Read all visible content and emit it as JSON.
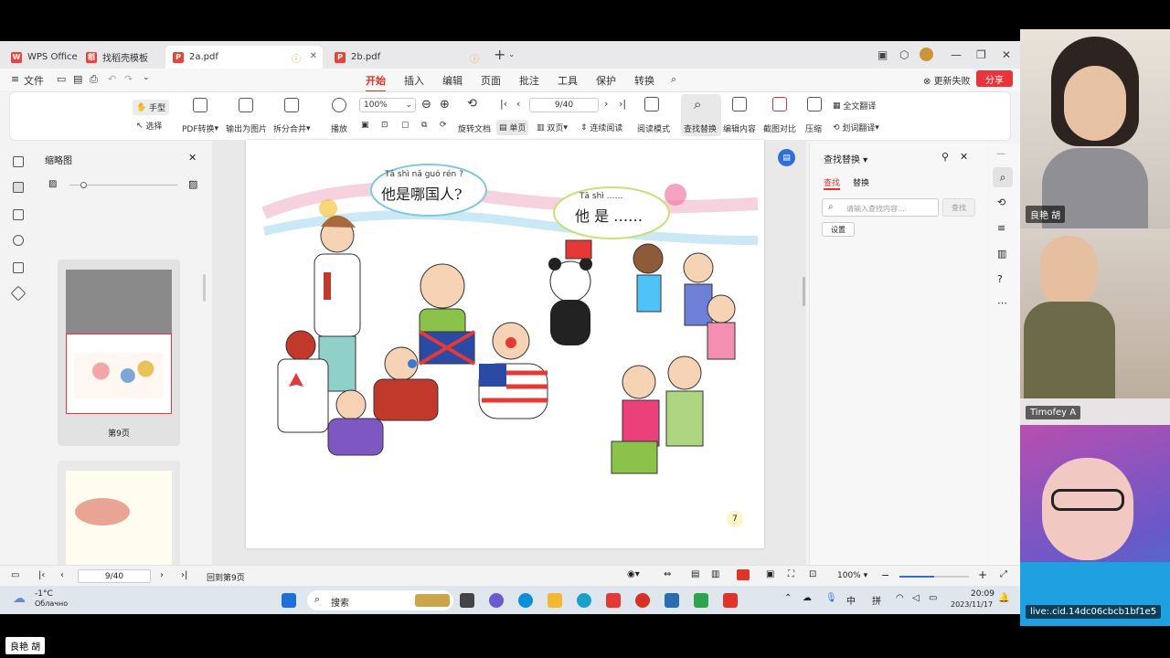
{
  "tabs": [
    {
      "label": "WPS Office"
    },
    {
      "label": "找稻壳模板"
    },
    {
      "label": "2a.pdf"
    },
    {
      "label": "2b.pdf"
    }
  ],
  "menu": {
    "file": "文件",
    "items": [
      "开始",
      "插入",
      "编辑",
      "页面",
      "批注",
      "工具",
      "保护",
      "转换"
    ],
    "update_fail": "更新失败",
    "share": "分享"
  },
  "toolbar": {
    "hand": "手型",
    "select": "选择",
    "pdf_convert": "PDF转换",
    "export_image": "输出为图片",
    "split_merge": "拆分合并",
    "play": "播放",
    "zoom": "100%",
    "rotate_doc": "旋转文档",
    "single_page": "单页",
    "double_page": "双页",
    "continuous": "连续阅读",
    "read_mode": "阅读模式",
    "find_replace": "查找替换",
    "edit_content": "编辑内容",
    "screenshot_compare": "截图对比",
    "compress": "压缩",
    "full_translate": "全文翻译",
    "word_translate": "划词翻译",
    "page_input": "9/40"
  },
  "thumbnails": {
    "title": "缩略图",
    "page_label": "第9页"
  },
  "page_content": {
    "bubble1_pinyin": "Tā shì nǎ guó rén ?",
    "bubble1_text": "他是哪国人?",
    "bubble2_pinyin": "Tā shì ……",
    "bubble2_text": "他 是 ……",
    "page_number": "7"
  },
  "find_panel": {
    "title": "查找替换",
    "tab_find": "查找",
    "tab_replace": "替换",
    "placeholder": "请输入查找内容...",
    "find_button": "查找",
    "settings_button": "设置"
  },
  "statusbar": {
    "page_input": "9/40",
    "back_label": "回到第9页",
    "zoom": "100%"
  },
  "taskbar": {
    "temp": "-1°C",
    "weather": "Облачно",
    "search": "搜索",
    "ime1": "中",
    "ime2": "拼",
    "time": "20:09",
    "date": "2023/11/17"
  },
  "participants": [
    {
      "name": "良艳 胡"
    },
    {
      "name": "Timofey A"
    },
    {
      "name": "live:.cid.14dc06cbcb1bf1e5"
    }
  ],
  "bottom_name": "良艳 胡",
  "colors": {
    "accent": "#e0342a",
    "find_blue": "#2e6fd8"
  }
}
